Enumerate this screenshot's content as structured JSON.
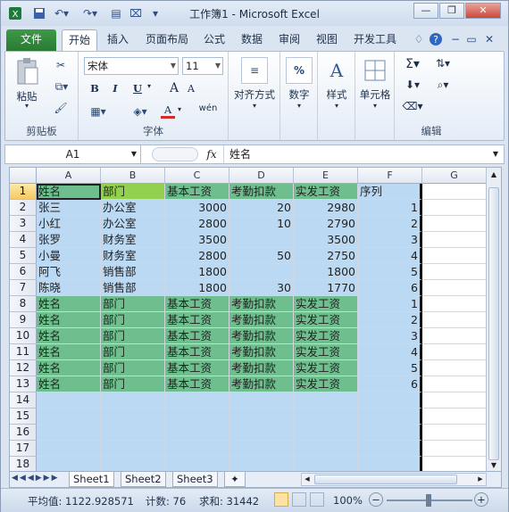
{
  "window": {
    "title": "工作簿1 - Microsoft Excel"
  },
  "tabs": [
    "文件",
    "开始",
    "插入",
    "页面布局",
    "公式",
    "数据",
    "审阅",
    "视图",
    "开发工具"
  ],
  "ribbon": {
    "clipboard": {
      "paste": "粘贴",
      "label": "剪贴板"
    },
    "font": {
      "name": "宋体",
      "size": "11",
      "label": "字体",
      "bold": "B",
      "italic": "I",
      "underline": "U",
      "grow": "A",
      "shrink": "A",
      "color": "A",
      "wen": "wén"
    },
    "alignment": {
      "label": "对齐方式"
    },
    "number": {
      "label": "数字",
      "icon": "%"
    },
    "styles": {
      "label": "样式"
    },
    "cells": {
      "label": "单元格"
    },
    "editing": {
      "label": "编辑"
    }
  },
  "formula_bar": {
    "name_box": "A1",
    "fx": "fx",
    "content": "姓名"
  },
  "columns": [
    "A",
    "B",
    "C",
    "D",
    "E",
    "F",
    "G"
  ],
  "rows": [
    [
      "姓名",
      "部门",
      "基本工资",
      "考勤扣款",
      "实发工资",
      "序列"
    ],
    [
      "张三",
      "办公室",
      "3000",
      "20",
      "2980",
      "1"
    ],
    [
      "小红",
      "办公室",
      "2800",
      "10",
      "2790",
      "2"
    ],
    [
      "张罗",
      "财务室",
      "3500",
      "",
      "3500",
      "3"
    ],
    [
      "小曼",
      "财务室",
      "2800",
      "50",
      "2750",
      "4"
    ],
    [
      "阿飞",
      "销售部",
      "1800",
      "",
      "1800",
      "5"
    ],
    [
      "陈晓",
      "销售部",
      "1800",
      "30",
      "1770",
      "6"
    ],
    [
      "姓名",
      "部门",
      "基本工资",
      "考勤扣款",
      "实发工资",
      "1"
    ],
    [
      "姓名",
      "部门",
      "基本工资",
      "考勤扣款",
      "实发工资",
      "2"
    ],
    [
      "姓名",
      "部门",
      "基本工资",
      "考勤扣款",
      "实发工资",
      "3"
    ],
    [
      "姓名",
      "部门",
      "基本工资",
      "考勤扣款",
      "实发工资",
      "4"
    ],
    [
      "姓名",
      "部门",
      "基本工资",
      "考勤扣款",
      "实发工资",
      "5"
    ],
    [
      "姓名",
      "部门",
      "基本工资",
      "考勤扣款",
      "实发工资",
      "6"
    ],
    [
      "",
      "",
      "",
      "",
      "",
      ""
    ],
    [
      "",
      "",
      "",
      "",
      "",
      ""
    ],
    [
      "",
      "",
      "",
      "",
      "",
      ""
    ],
    [
      "",
      "",
      "",
      "",
      "",
      ""
    ],
    [
      "",
      "",
      "",
      "",
      "",
      ""
    ]
  ],
  "row_numbers": [
    "1",
    "2",
    "3",
    "4",
    "5",
    "6",
    "7",
    "8",
    "9",
    "10",
    "11",
    "12",
    "13",
    "14",
    "15",
    "16",
    "17",
    "18"
  ],
  "sheets": [
    "Sheet1",
    "Sheet2",
    "Sheet3"
  ],
  "status": {
    "average": "平均值: 1122.928571",
    "count": "计数: 76",
    "sum": "求和: 31442",
    "zoom": "100%"
  },
  "colors": {
    "green": "#6fbf8e",
    "blue": "#bcd9f4",
    "bright_green": "#92d050"
  }
}
